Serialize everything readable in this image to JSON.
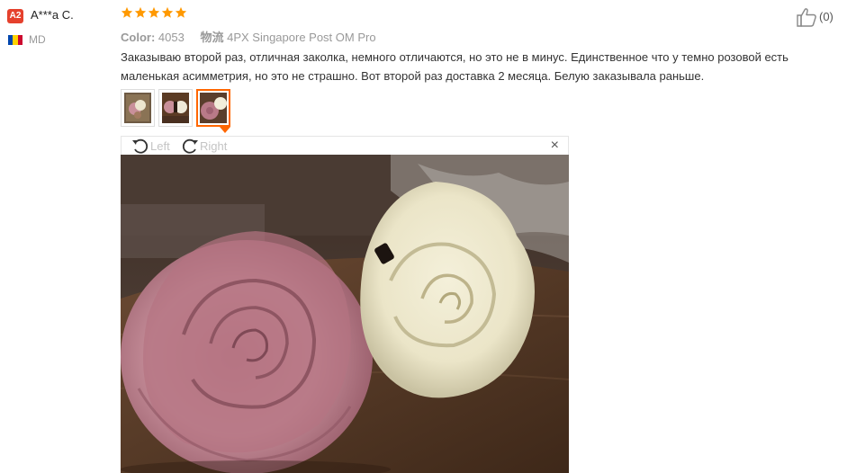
{
  "reviewer": {
    "level_badge": "A2",
    "name": "A***a C.",
    "country": "MD"
  },
  "review": {
    "rating": 5,
    "color_label": "Color:",
    "color_value": "4053",
    "shipping_label": "物流",
    "shipping_value": "4PX Singapore Post OM Pro",
    "text": "Заказываю второй раз, отличная заколка, немного отличаются, но это не в минус. Единственное что у темно розовой есть маленькая асимметрия, но это не страшно. Вот второй раз доставка 2 месяца. Белую заказывала раньше."
  },
  "helpful": {
    "count": "(0)"
  },
  "viewer": {
    "rotate_left_label": "Left",
    "rotate_right_label": "Right",
    "close_label": "×",
    "active_thumbnail": 3
  },
  "colors": {
    "star": "#ff9900",
    "badge": "#e5412d",
    "active_border": "#ff6600",
    "muted_text": "#999999"
  },
  "icons": [
    "star-icon",
    "thumbs-up-icon",
    "rotate-left-icon",
    "rotate-right-icon",
    "close-icon"
  ]
}
